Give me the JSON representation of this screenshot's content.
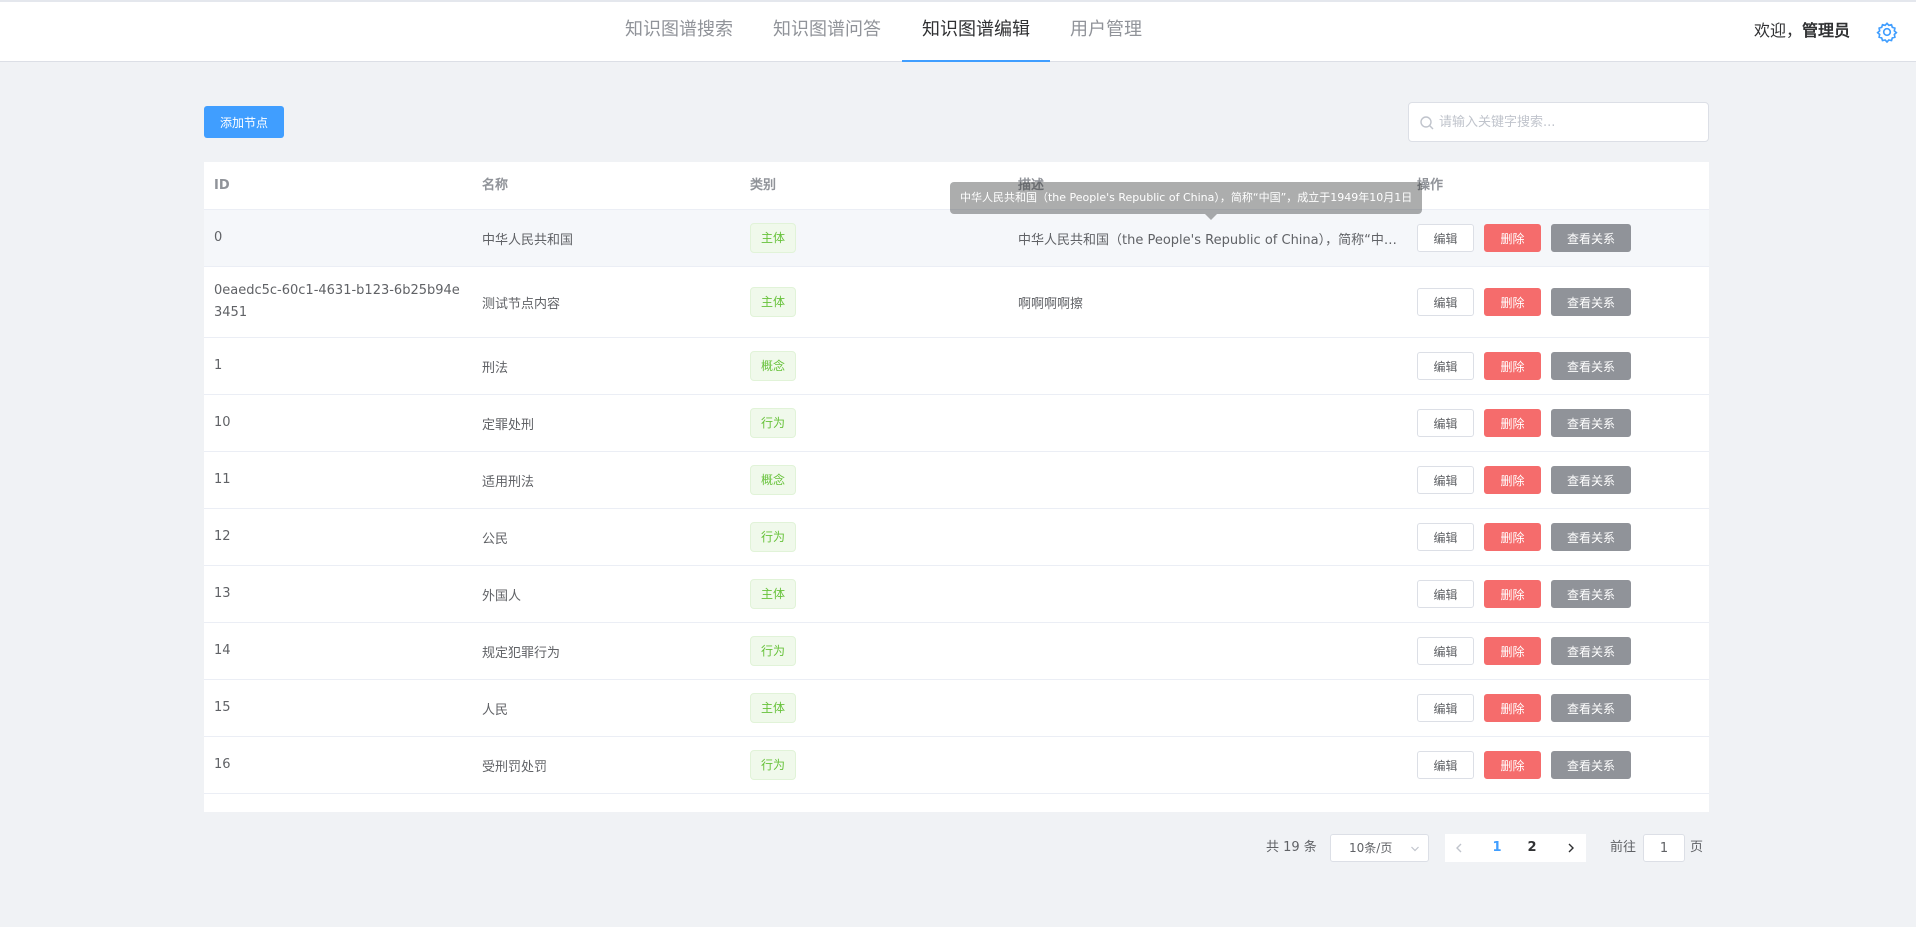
{
  "header": {
    "nav": [
      {
        "label": "知识图谱搜索",
        "active": false
      },
      {
        "label": "知识图谱问答",
        "active": false
      },
      {
        "label": "知识图谱编辑",
        "active": true
      },
      {
        "label": "用户管理",
        "active": false
      }
    ],
    "welcome_prefix": "欢迎，",
    "user_name": "管理员",
    "settings_icon": "gear-icon"
  },
  "toolbar": {
    "add_label": "添加节点",
    "search_placeholder": "请输入关键字搜索...",
    "search_icon": "search-icon"
  },
  "table": {
    "headers": [
      "ID",
      "名称",
      "类别",
      "描述",
      "操作"
    ],
    "rows": [
      {
        "id": "0",
        "name": "中华人民共和国",
        "category": "主体",
        "description": "中华人民共和国（the People's Republic of China），简称“中国”，成立于1949年10月1日"
      },
      {
        "id": "0eaedc5c-60c1-4631-b123-6b25b94e3451",
        "name": "测试节点内容",
        "category": "主体",
        "description": "啊啊啊啊擦"
      },
      {
        "id": "1",
        "name": "刑法",
        "category": "概念",
        "description": ""
      },
      {
        "id": "10",
        "name": "定罪处刑",
        "category": "行为",
        "description": ""
      },
      {
        "id": "11",
        "name": "适用刑法",
        "category": "概念",
        "description": ""
      },
      {
        "id": "12",
        "name": "公民",
        "category": "行为",
        "description": ""
      },
      {
        "id": "13",
        "name": "外国人",
        "category": "主体",
        "description": ""
      },
      {
        "id": "14",
        "name": "规定犯罪行为",
        "category": "行为",
        "description": ""
      },
      {
        "id": "15",
        "name": "人民",
        "category": "主体",
        "description": ""
      },
      {
        "id": "16",
        "name": "受刑罚处罚",
        "category": "行为",
        "description": ""
      }
    ],
    "ops": {
      "edit": "编辑",
      "delete": "删除",
      "view": "查看关系"
    }
  },
  "tooltip": {
    "text": "中华人民共和国（the People's Republic of China），简称“中国”，成立于1949年10月1日"
  },
  "pagination": {
    "total_text": "共 19 条",
    "page_size": "10条/页",
    "pages": [
      "1",
      "2"
    ],
    "current_page": "1",
    "goto_label": "前往",
    "goto_value": "1",
    "page_unit": "页"
  }
}
